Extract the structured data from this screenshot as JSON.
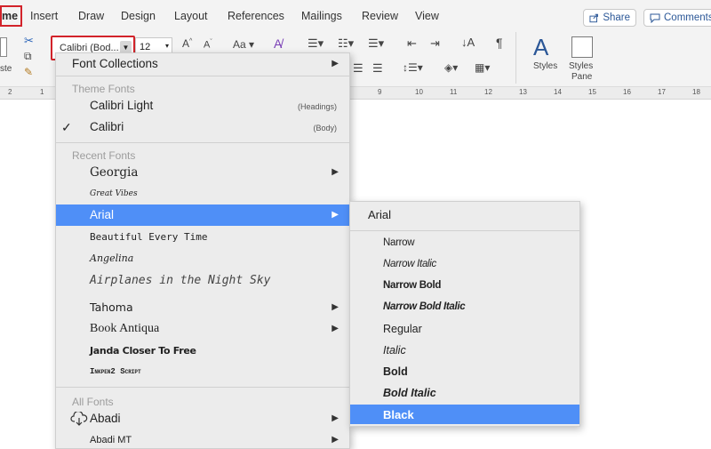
{
  "ribbon": {
    "tabs": [
      "me",
      "Insert",
      "Draw",
      "Design",
      "Layout",
      "References",
      "Mailings",
      "Review",
      "View"
    ],
    "share_label": "Share",
    "comments_label": "Comments"
  },
  "toolbar": {
    "font_name": "Calibri (Bod...",
    "font_size": "12",
    "change_case": "Aa",
    "paste_fragment": "ste",
    "styles_label": "Styles",
    "styles_pane_label1": "Styles",
    "styles_pane_label2": "Pane"
  },
  "ruler": {
    "left_numbers": [
      "2",
      "1"
    ],
    "numbers": [
      "9",
      "10",
      "11",
      "12",
      "13",
      "14",
      "15",
      "16",
      "17",
      "18"
    ]
  },
  "font_menu": {
    "font_collections": "Font Collections",
    "theme_header": "Theme Fonts",
    "theme_fonts": [
      {
        "name": "Calibri Light",
        "hint": "(Headings)"
      },
      {
        "name": "Calibri",
        "hint": "(Body)",
        "checked_mark": "✓"
      }
    ],
    "recent_header": "Recent Fonts",
    "recent_fonts": [
      "Georgia",
      "Great Vibes",
      "Arial",
      "Beautiful Every Time",
      "Angelina",
      "Airplanes in the Night Sky",
      "Tahoma",
      "Book Antiqua",
      "Janda Closer To Free",
      "Inkpen2 Script"
    ],
    "all_header": "All Fonts",
    "all_fonts": [
      "Abadi",
      "Abadi MT"
    ],
    "selected": "Arial"
  },
  "submenu": {
    "title": "Arial",
    "styles": [
      "Narrow",
      "Narrow Italic",
      "Narrow Bold",
      "Narrow Bold Italic",
      "Regular",
      "Italic",
      "Bold",
      "Bold Italic",
      "Black"
    ],
    "selected": "Black"
  },
  "colors": {
    "highlight": "#4f8ff7",
    "annotation_red": "#d2232a",
    "menu_bg": "#ececec"
  }
}
